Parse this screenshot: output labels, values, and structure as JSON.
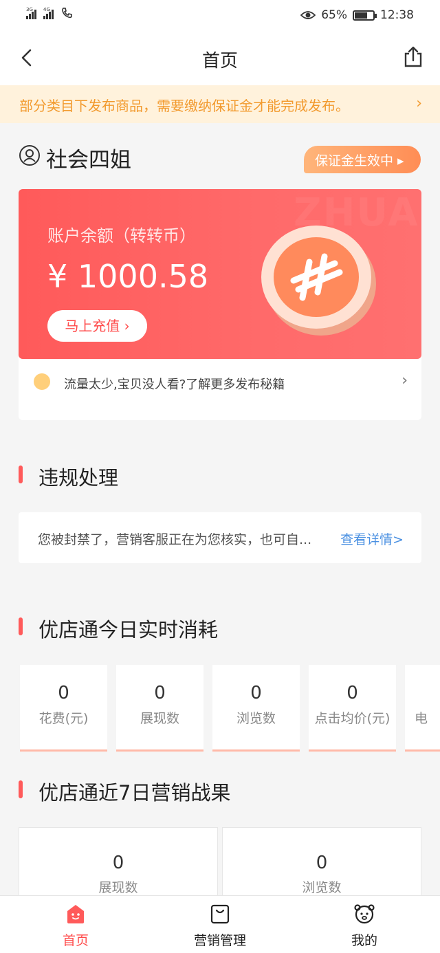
{
  "status_bar": {
    "signal1": "3G",
    "signal2": "4G",
    "battery": "65%",
    "time": "12:38"
  },
  "header": {
    "title": "首页",
    "back_icon": "chevron-left-icon",
    "share_icon": "share-icon"
  },
  "notice": {
    "text": "部分类目下发布商品，需要缴纳保证金才能完成发布。",
    "chevron": "›"
  },
  "user": {
    "name": "社会四姐",
    "deposit_badge": "保证金生效中 ▸"
  },
  "balance_card": {
    "label": "账户余额（转转币）",
    "amount": "¥ 1000.58",
    "recharge_label": "马上充值 ›",
    "watermark": "ZHUANZ",
    "tip_text": "流量太少,宝贝没人看?了解更多发布秘籍",
    "tip_chevron": "›"
  },
  "violation": {
    "section_title": "违规处理",
    "message": "您被封禁了，营销客服正在为您核实，也可自...",
    "link": "查看详情>"
  },
  "today": {
    "section_title": "优店通今日实时消耗",
    "metrics": [
      {
        "value": "0",
        "label": "花费(元)"
      },
      {
        "value": "0",
        "label": "展现数"
      },
      {
        "value": "0",
        "label": "浏览数"
      },
      {
        "value": "0",
        "label": "点击均价(元)"
      },
      {
        "value": "",
        "label": "电"
      }
    ]
  },
  "week": {
    "section_title": "优店通近7日营销战果",
    "metrics": [
      {
        "value": "0",
        "label": "展现数"
      },
      {
        "value": "0",
        "label": "浏览数"
      }
    ]
  },
  "bottom_nav": {
    "items": [
      {
        "label": "首页",
        "icon": "home-face-icon",
        "active": true
      },
      {
        "label": "营销管理",
        "icon": "bag-icon",
        "active": false
      },
      {
        "label": "我的",
        "icon": "bear-face-icon",
        "active": false
      }
    ]
  },
  "colors": {
    "accent": "#ff4b4b",
    "notice_bg": "#fff2dc",
    "notice_text": "#f29a2e",
    "link": "#4a90e2"
  }
}
